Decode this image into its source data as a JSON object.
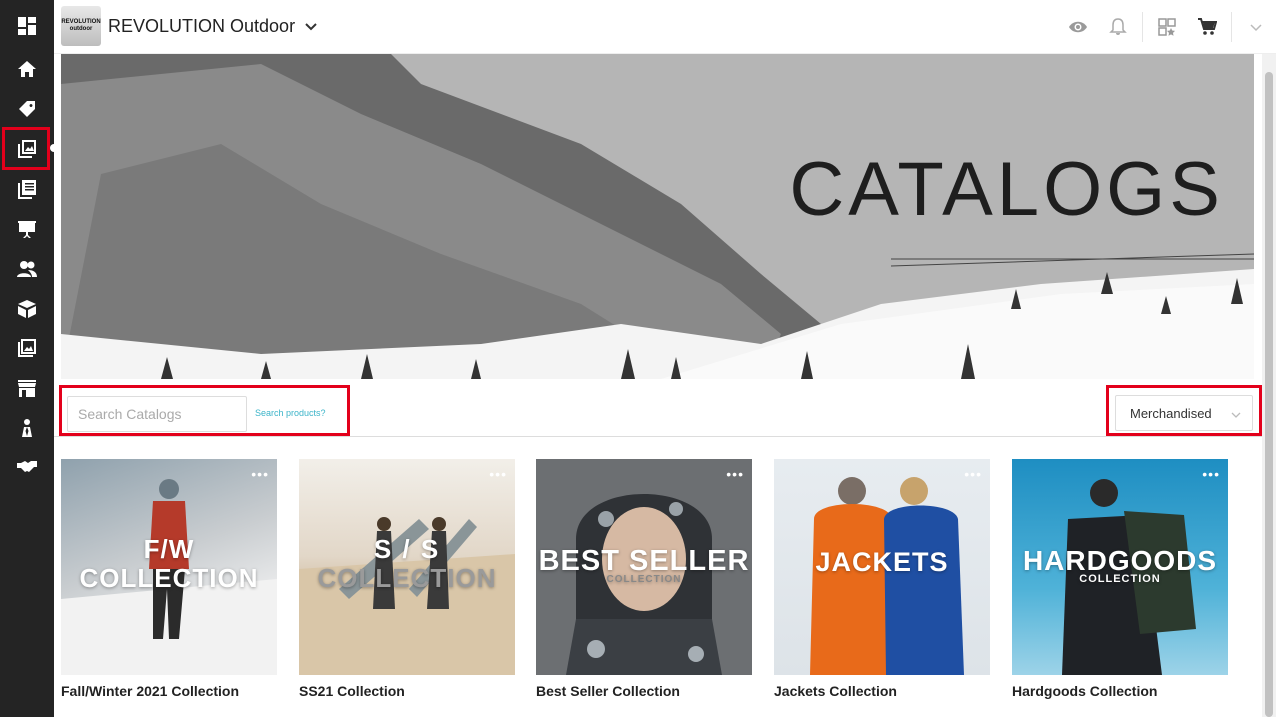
{
  "app": {
    "brand_name": "REVOLUTION Outdoor",
    "logo_text_line1": "REVOLUTION",
    "logo_text_line2": "outdoor"
  },
  "sidebar": {
    "items": [
      {
        "icon": "dashboard-icon"
      },
      {
        "icon": "home-icon"
      },
      {
        "icon": "tag-icon"
      },
      {
        "icon": "catalogs-icon",
        "active": true
      },
      {
        "icon": "linesheets-icon"
      },
      {
        "icon": "presentation-icon"
      },
      {
        "icon": "customers-icon"
      },
      {
        "icon": "box-icon"
      },
      {
        "icon": "images-icon"
      },
      {
        "icon": "storefront-icon"
      },
      {
        "icon": "salesman-icon"
      },
      {
        "icon": "handshake-icon"
      }
    ]
  },
  "topbar": {
    "icons": [
      "eye-icon",
      "bell-icon",
      "qr-icon",
      "cart-icon",
      "chevron-down-icon"
    ]
  },
  "hero": {
    "title": "CATALOGS"
  },
  "filters": {
    "search_placeholder": "Search Catalogs",
    "search_products_link": "Search products?",
    "sort_value": "Merchandised"
  },
  "catalogs": [
    {
      "label": "Fall/Winter 2021 Collection",
      "overlay_line1": "F/W",
      "overlay_line2": "COLLECTION"
    },
    {
      "label": "SS21 Collection",
      "overlay_line1": "S / S",
      "overlay_line2": "COLLECTION"
    },
    {
      "label": "Best Seller Collection",
      "overlay_line1": "BEST SELLER",
      "overlay_line2": "COLLECTION"
    },
    {
      "label": "Jackets Collection",
      "overlay_line1": "JACKETS",
      "overlay_line2": ""
    },
    {
      "label": "Hardgoods Collection",
      "overlay_line1": "HARDGOODS",
      "overlay_line2": "COLLECTION"
    }
  ],
  "colors": {
    "sidebar_bg": "#242424",
    "highlight": "#e3001b",
    "link": "#3cb4c9"
  }
}
